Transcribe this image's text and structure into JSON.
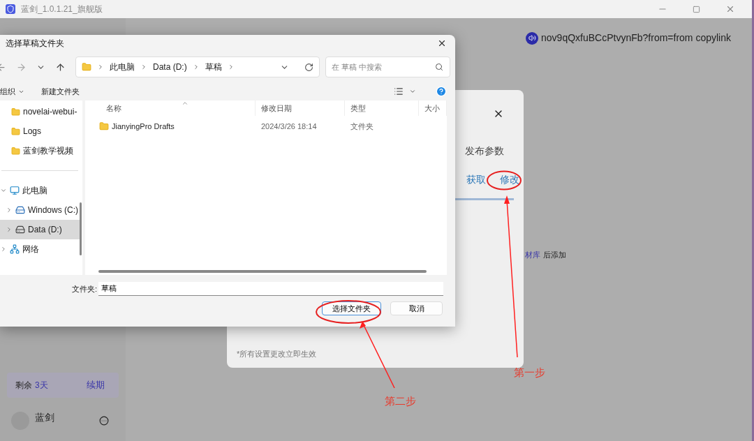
{
  "app_window": {
    "title": "蓝剑_1.0.1.21_旗舰版",
    "link_text": "nov9qQxfuBCcPtvynFb?from=from copylink",
    "sidebar": {
      "remaining_label": "剩余",
      "remaining_value": "3天",
      "renew": "续期",
      "user_name": "蓝剑"
    },
    "settings_panel": {
      "heading": "发布参数",
      "actions": [
        {
          "label": "获取"
        },
        {
          "label": "修改"
        }
      ],
      "note": "*所有设置更改立即生效"
    },
    "hint": {
      "link": "材库",
      "text": "后添加"
    }
  },
  "file_dialog": {
    "title": "选择草稿文件夹",
    "breadcrumbs": [
      "此电脑",
      "Data (D:)",
      "草稿"
    ],
    "search": {
      "placeholder": "在 草稿 中搜索"
    },
    "toolbar": {
      "organize": "组织",
      "new_folder": "新建文件夹"
    },
    "quick_access": [
      {
        "label": "novelai-webui-",
        "selected": false
      },
      {
        "label": "Logs",
        "selected": false
      },
      {
        "label": "蓝剑教学视频",
        "selected": false
      }
    ],
    "tree": [
      {
        "label": "此电脑",
        "kind": "pc",
        "expanded": true,
        "selected": false,
        "children": [
          {
            "label": "Windows (C:)",
            "kind": "system_drive",
            "expanded": false,
            "selected": false
          },
          {
            "label": "Data (D:)",
            "kind": "drive",
            "expanded": false,
            "selected": true
          }
        ]
      },
      {
        "label": "网络",
        "kind": "network",
        "expanded": false,
        "selected": false
      }
    ],
    "columns": [
      "名称",
      "修改日期",
      "类型",
      "大小"
    ],
    "rows": [
      {
        "name": "JianyingPro Drafts",
        "date": "2024/3/26 18:14",
        "type": "文件夹"
      }
    ],
    "folder_label": "文件夹:",
    "folder_value": "草稿",
    "buttons": [
      {
        "label": "选择文件夹",
        "kind": "primary"
      },
      {
        "label": "取消",
        "kind": "secondary"
      }
    ]
  },
  "annotations": [
    {
      "label": "第一步"
    },
    {
      "label": "第二步"
    }
  ]
}
